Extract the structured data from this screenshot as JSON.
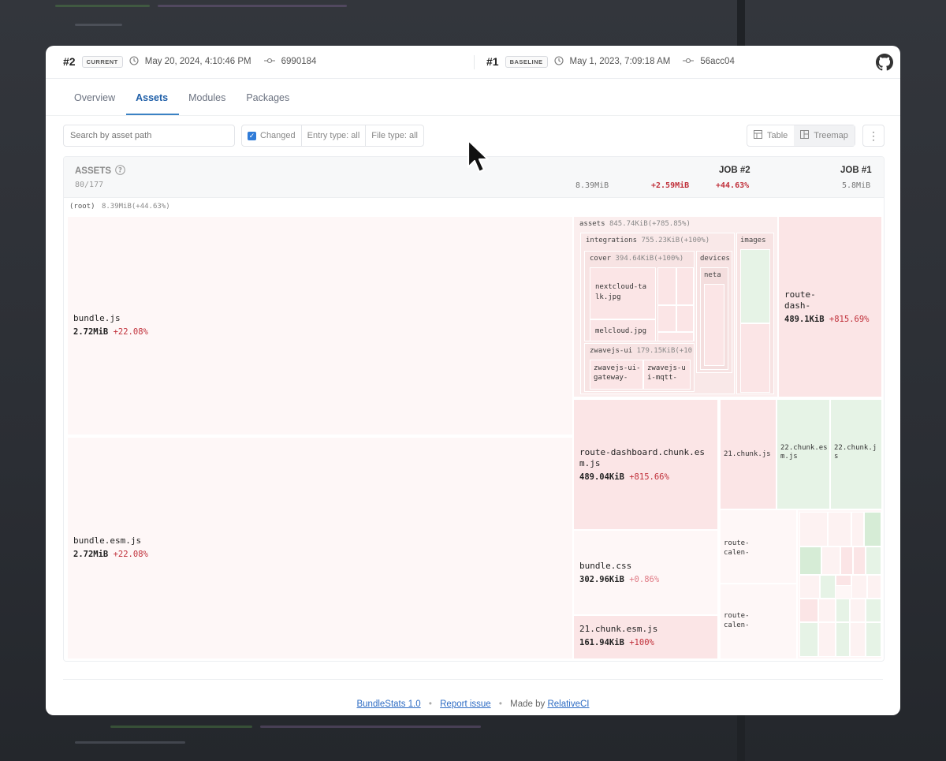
{
  "header": {
    "current": {
      "num": "#2",
      "badge": "CURRENT",
      "date": "May 20, 2024, 4:10:46 PM",
      "commit": "6990184"
    },
    "baseline": {
      "num": "#1",
      "badge": "BASELINE",
      "date": "May 1, 2023, 7:09:18 AM",
      "commit": "56acc04"
    },
    "github_icon": "github-icon"
  },
  "tabs": [
    {
      "label": "Overview"
    },
    {
      "label": "Assets"
    },
    {
      "label": "Modules"
    },
    {
      "label": "Packages"
    }
  ],
  "filters": {
    "search_placeholder": "Search by asset path",
    "changed": "Changed",
    "entry_type": "Entry type: all",
    "file_type": "File type: all"
  },
  "view": {
    "table": "Table",
    "treemap": "Treemap",
    "more": "⋮"
  },
  "table_header": {
    "title": "ASSETS",
    "count": "80/177",
    "job2": "JOB #2",
    "job1": "JOB #1",
    "size": "8.39MiB",
    "delta": "+2.59MiB",
    "delta_pct": "+44.63%",
    "baseline_size": "5.8MiB"
  },
  "treemap": {
    "root": "(root)",
    "root_info": "8.39MiB(+44.63%)",
    "bundle_js": {
      "name": "bundle.js",
      "size": "2.72MiB",
      "pct": "+22.08%"
    },
    "bundle_esm": {
      "name": "bundle.esm.js",
      "size": "2.72MiB",
      "pct": "+22.08%"
    },
    "assets": {
      "name": "assets",
      "info": "845.74KiB(+785.85%)"
    },
    "integrations": {
      "name": "integrations",
      "info": "755.23KiB(+100%)"
    },
    "images": "images",
    "cover": {
      "name": "cover",
      "info": "394.64KiB(+100%)"
    },
    "devices": "devices",
    "neta": "neta",
    "nextcloud": "nextcloud-talk.jpg",
    "melcloud": "melcloud.jpg",
    "zwavejs": {
      "name": "zwavejs-ui",
      "info": "179.15KiB(+10"
    },
    "zw1": "zwavejs-ui-gateway-",
    "zw2": "zwavejs-ui-mqtt-",
    "route_dash_small": {
      "name": "route-dash-",
      "size": "489.1KiB",
      "pct": "+815.69%"
    },
    "route_dash": {
      "name": "route-dashboard.chunk.esm.js",
      "size": "489.04KiB",
      "pct": "+815.66%"
    },
    "chunk21": "21.chunk.js",
    "chunk22esm": "22.chunk.esm.js",
    "chunk22": "22.chunk.js",
    "bundle_css": {
      "name": "bundle.css",
      "size": "302.96KiB",
      "pct": "+0.86%"
    },
    "route_cal1": "route-calen-",
    "route_cal2": "route-calen-",
    "chunk21esm": {
      "name": "21.chunk.esm.js",
      "size": "161.94KiB",
      "pct": "+100%"
    }
  },
  "footer": {
    "version": "BundleStats 1.0",
    "dot": "•",
    "report": "Report issue",
    "made_by": "Made by",
    "author": "RelativeCI"
  },
  "colors": {
    "accent": "#1f5fa8",
    "negative": "#c0303a",
    "added": "#e6f3e6"
  }
}
